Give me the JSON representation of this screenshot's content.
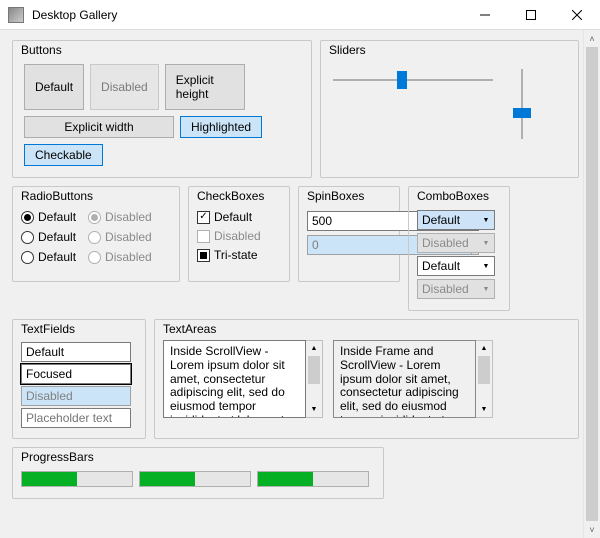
{
  "window": {
    "title": "Desktop Gallery"
  },
  "groups": {
    "buttons": "Buttons",
    "sliders": "Sliders",
    "radios": "RadioButtons",
    "checks": "CheckBoxes",
    "spins": "SpinBoxes",
    "combos": "ComboBoxes",
    "textfields": "TextFields",
    "textareas": "TextAreas",
    "progress": "ProgressBars"
  },
  "buttons": {
    "default": "Default",
    "disabled": "Disabled",
    "explicit_height": "Explicit height",
    "explicit_width": "Explicit width",
    "highlighted": "Highlighted",
    "checkable": "Checkable"
  },
  "sliders": {
    "h_value_pct": 40,
    "v_value_pct": 55
  },
  "radios": {
    "col1": [
      "Default",
      "Default",
      "Default"
    ],
    "col2": [
      "Disabled",
      "Disabled",
      "Disabled"
    ],
    "col1_checked": 0,
    "col2_checked": 0
  },
  "checks": [
    {
      "label": "Default",
      "state": "checked",
      "disabled": false
    },
    {
      "label": "Disabled",
      "state": "unchecked",
      "disabled": true
    },
    {
      "label": "Tri-state",
      "state": "tri",
      "disabled": false
    }
  ],
  "spins": [
    {
      "value": "500",
      "disabled": false
    },
    {
      "value": "0",
      "disabled": true
    }
  ],
  "combos": [
    {
      "value": "Default",
      "disabled": false,
      "selected": true,
      "editable": false
    },
    {
      "value": "Disabled",
      "disabled": true,
      "selected": false,
      "editable": false
    },
    {
      "value": "Default",
      "disabled": false,
      "selected": false,
      "editable": true
    },
    {
      "value": "Disabled",
      "disabled": true,
      "selected": false,
      "editable": true
    }
  ],
  "textfields": {
    "default": "Default",
    "focused": "Focused",
    "disabled": "Disabled",
    "placeholder": "Placeholder text"
  },
  "textareas": {
    "a": "Inside ScrollView - Lorem ipsum dolor sit amet, consectetur adipiscing elit, sed do eiusmod tempor incididunt ut labore et dolore magna aliqua. Ut enim ad",
    "b": "Inside Frame and ScrollView - Lorem ipsum dolor sit amet, consectetur adipiscing elit, sed do eiusmod tempor incididunt ut labore et dolore magna aliqua. Ut enim ad"
  },
  "progress": [
    50,
    50,
    50
  ]
}
